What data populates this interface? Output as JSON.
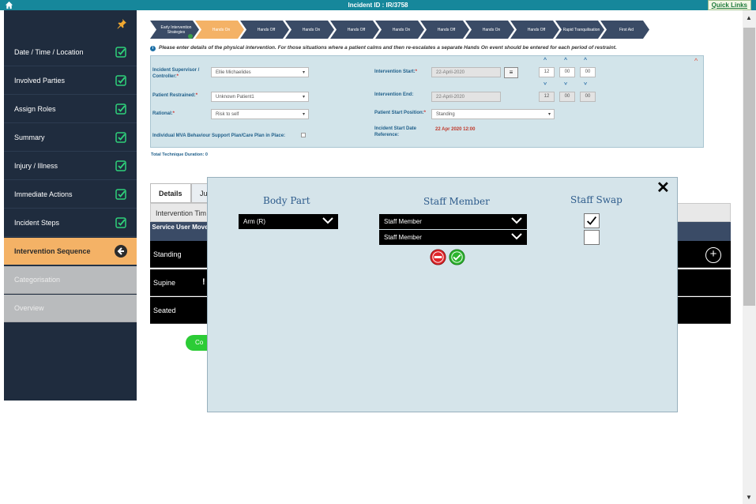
{
  "topbar": {
    "title": "Incident ID : IR/3758",
    "quick_links": "Quick Links"
  },
  "sidebar": {
    "items": [
      {
        "label": "Date / Time / Location",
        "state": "done"
      },
      {
        "label": "Involved Parties",
        "state": "done"
      },
      {
        "label": "Assign Roles",
        "state": "done"
      },
      {
        "label": "Summary",
        "state": "done"
      },
      {
        "label": "Injury / Illness",
        "state": "done"
      },
      {
        "label": "Immediate Actions",
        "state": "done"
      },
      {
        "label": "Incident Steps",
        "state": "done"
      },
      {
        "label": "Intervention Sequence",
        "state": "active"
      },
      {
        "label": "Categorisation",
        "state": "disabled"
      },
      {
        "label": "Overview",
        "state": "disabled"
      }
    ]
  },
  "steps": [
    {
      "label": "Early Intervention Strategies"
    },
    {
      "label": "Hands On"
    },
    {
      "label": "Hands Off"
    },
    {
      "label": "Hands On"
    },
    {
      "label": "Hands Off"
    },
    {
      "label": "Hands On"
    },
    {
      "label": "Hands Off"
    },
    {
      "label": "Hands On"
    },
    {
      "label": "Hands Off"
    },
    {
      "label": "Rapid Tranquilisation"
    },
    {
      "label": "First Aid"
    }
  ],
  "info_text": "Please enter details of the physical intervention. For those situations where a patient calms and then re-escalates a separate Hands On event should be entered for each period of restraint.",
  "form": {
    "supervisor_label": "Incident Supervisor / Controller:",
    "supervisor_value": "Ellie Michaelides",
    "patient_label": "Patient Restrained:",
    "patient_value": "Unknown Patient1",
    "rational_label": "Rational:",
    "rational_value": "Risk to self",
    "mva_label": "Individual MVA Behaviour Support Plan/Care Plan in Place:",
    "start_label": "Intervention Start:",
    "start_date": "22-April-2020",
    "start_h": "12",
    "start_m": "00",
    "start_s": "00",
    "end_label": "Intervention End:",
    "end_date": "22-April-2020",
    "end_h": "12",
    "end_m": "00",
    "end_s": "00",
    "position_label": "Patient Start Position:",
    "position_value": "Standing",
    "ref_label": "Incident Start Date Reference:",
    "ref_value": "22 Apr 2020 12:00",
    "required_marker": "*"
  },
  "duration": {
    "label": "Total Technique Duration:",
    "value": "0"
  },
  "tabs": [
    {
      "label": "Details"
    },
    {
      "label": "Ju"
    }
  ],
  "table": {
    "header": "Intervention Tim",
    "subheader": "Service User Movement",
    "rows": [
      {
        "label": "Standing"
      },
      {
        "label": "Supine",
        "flag": "!"
      },
      {
        "label": "Seated"
      }
    ],
    "add_symbol": "+"
  },
  "continue_button": "Co",
  "modal": {
    "body_part_header": "Body Part",
    "staff_member_header": "Staff Member",
    "staff_swap_header": "Staff Swap",
    "body_part_value": "Arm (R)",
    "staff_rows": [
      {
        "value": "Staff Member",
        "swap": true
      },
      {
        "value": "Staff Member",
        "swap": false
      }
    ],
    "close": "✕"
  },
  "colors": {
    "topbar": "#16879b",
    "sidebar": "#1f2c3e",
    "active": "#f4b266",
    "step_dark": "#3a4b66",
    "step_highlight": "#f4b266",
    "check": "#2fd07a"
  }
}
